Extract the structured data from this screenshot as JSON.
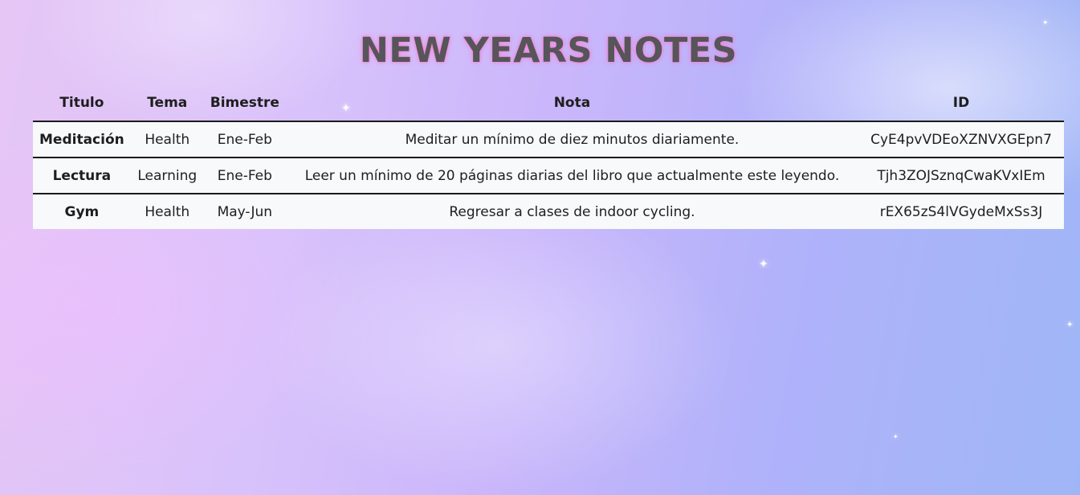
{
  "page": {
    "title": "NEW YEARS NOTES"
  },
  "table": {
    "headers": {
      "titulo": "Titulo",
      "tema": "Tema",
      "bimestre": "Bimestre",
      "nota": "Nota",
      "id": "ID"
    },
    "rows": [
      {
        "titulo": "Meditación",
        "tema": "Health",
        "bimestre": "Ene-Feb",
        "nota": "Meditar un mínimo de diez minutos diariamente.",
        "id": "CyE4pvVDEoXZNVXGEpn7"
      },
      {
        "titulo": "Lectura",
        "tema": "Learning",
        "bimestre": "Ene-Feb",
        "nota": "Leer un mínimo de 20 páginas diarias del libro que actualmente este leyendo.",
        "id": "Tjh3ZOJSznqCwaKVxIEm"
      },
      {
        "titulo": "Gym",
        "tema": "Health",
        "bimestre": "May-Jun",
        "nota": "Regresar a clases de indoor cycling.",
        "id": "rEX65zS4lVGydeMxSs3J"
      }
    ]
  },
  "colors": {
    "title_text": "#55555a",
    "title_glow": "#ff6ec8",
    "row_background": "#f8f9fb",
    "divider": "#1a1a1a"
  }
}
